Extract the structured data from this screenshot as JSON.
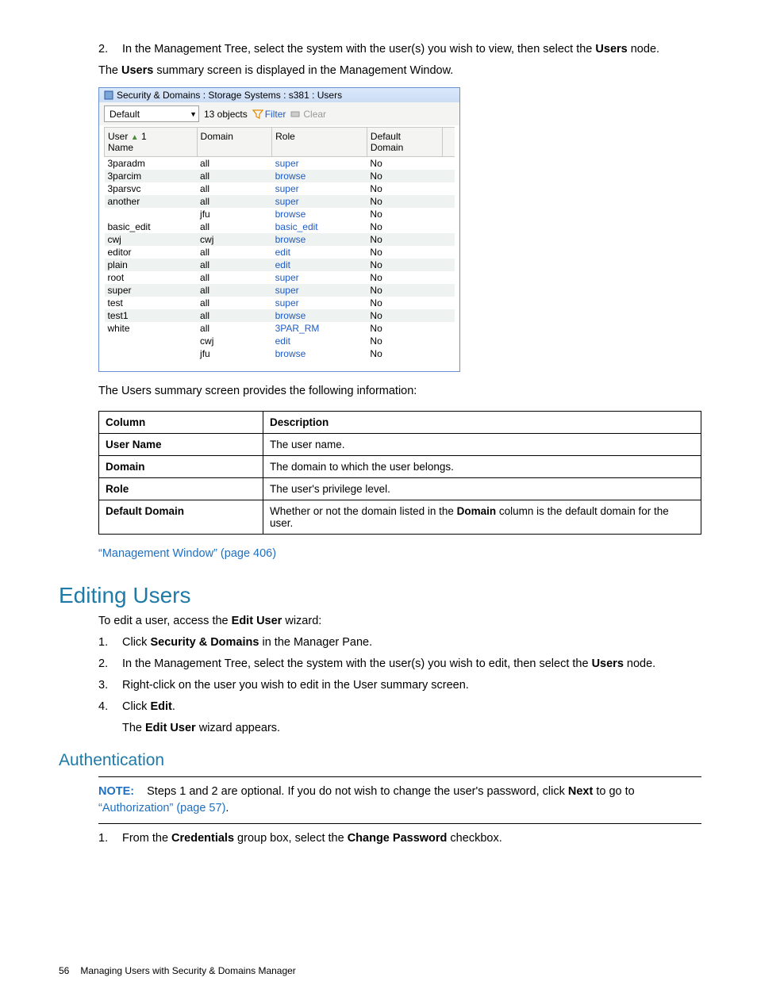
{
  "step2_prefix": "In the Management Tree, select the system with the user(s) you wish to view, then select the ",
  "step2_bold": "Users",
  "step2_suffix": " node.",
  "users_summary_pre": "The ",
  "users_summary_bold": "Users",
  "users_summary_post": " summary screen is displayed in the Management Window.",
  "panel": {
    "title": "Security & Domains : Storage Systems : s381 : Users",
    "dropdown": "Default",
    "count": "13 objects",
    "filter": "Filter",
    "clear": "Clear",
    "headers": {
      "c1a": "User",
      "c1b": "Name",
      "sort": "1",
      "c2": "Domain",
      "c3": "Role",
      "c4a": "Default",
      "c4b": "Domain"
    },
    "rows": [
      {
        "u": "3paradm",
        "d": "all",
        "r": "super",
        "dd": "No",
        "alt": false
      },
      {
        "u": "3parcim",
        "d": "all",
        "r": "browse",
        "dd": "No",
        "alt": true
      },
      {
        "u": "3parsvc",
        "d": "all",
        "r": "super",
        "dd": "No",
        "alt": false
      },
      {
        "u": "another",
        "d": "all",
        "r": "super",
        "dd": "No",
        "alt": true
      },
      {
        "u": "",
        "d": "jfu",
        "r": "browse",
        "dd": "No",
        "alt": false
      },
      {
        "u": "basic_edit",
        "d": "all",
        "r": "basic_edit",
        "dd": "No",
        "alt": false
      },
      {
        "u": "cwj",
        "d": "cwj",
        "r": "browse",
        "dd": "No",
        "alt": true
      },
      {
        "u": "editor",
        "d": "all",
        "r": "edit",
        "dd": "No",
        "alt": false
      },
      {
        "u": "plain",
        "d": "all",
        "r": "edit",
        "dd": "No",
        "alt": true
      },
      {
        "u": "root",
        "d": "all",
        "r": "super",
        "dd": "No",
        "alt": false
      },
      {
        "u": "super",
        "d": "all",
        "r": "super",
        "dd": "No",
        "alt": true
      },
      {
        "u": "test",
        "d": "all",
        "r": "super",
        "dd": "No",
        "alt": false
      },
      {
        "u": "test1",
        "d": "all",
        "r": "browse",
        "dd": "No",
        "alt": true
      },
      {
        "u": "white",
        "d": "all",
        "r": "3PAR_RM",
        "dd": "No",
        "alt": false
      },
      {
        "u": "",
        "d": "cwj",
        "r": "edit",
        "dd": "No",
        "alt": false
      },
      {
        "u": "",
        "d": "jfu",
        "r": "browse",
        "dd": "No",
        "alt": false
      }
    ]
  },
  "desc_intro": "The Users summary screen provides the following information:",
  "desc_table": {
    "h1": "Column",
    "h2": "Description",
    "rows": [
      {
        "c": "User Name",
        "d": "The user name."
      },
      {
        "c": "Domain",
        "d": "The domain to which the user belongs."
      },
      {
        "c": "Role",
        "d": "The user's privilege level."
      },
      {
        "c": "Default Domain",
        "d_pre": "Whether or not the domain listed in the ",
        "d_bold": "Domain",
        "d_post": " column is the default domain for the user."
      }
    ]
  },
  "xref": "“Management Window” (page 406)",
  "h2": "Editing Users",
  "edit_intro_pre": "To edit a user, access the ",
  "edit_intro_bold": "Edit User",
  "edit_intro_post": " wizard:",
  "ol": [
    {
      "n": "1.",
      "pre": "Click ",
      "b": "Security & Domains",
      "post": " in the Manager Pane."
    },
    {
      "n": "2.",
      "pre": "In the Management Tree, select the system with the user(s) you wish to edit, then select the ",
      "b": "Users",
      "post": " node."
    },
    {
      "n": "3.",
      "pre": "Right-click on the user you wish to edit in the User summary screen.",
      "b": "",
      "post": ""
    },
    {
      "n": "4.",
      "pre": "Click ",
      "b": "Edit",
      "post": "."
    }
  ],
  "result_pre": "The ",
  "result_bold": "Edit User",
  "result_post": " wizard appears.",
  "h3": "Authentication",
  "note": {
    "label": "NOTE:",
    "pre": "Steps 1 and 2 are optional. If you do not wish to change the user's password, click ",
    "b": "Next",
    "mid": " to go to ",
    "link": "“Authorization” (page 57)",
    "post": "."
  },
  "cred": {
    "n": "1.",
    "pre": "From the ",
    "b1": "Credentials",
    "mid": " group box, select the ",
    "b2": "Change Password",
    "post": " checkbox."
  },
  "footer": {
    "page": "56",
    "title": "Managing Users with Security & Domains Manager"
  }
}
